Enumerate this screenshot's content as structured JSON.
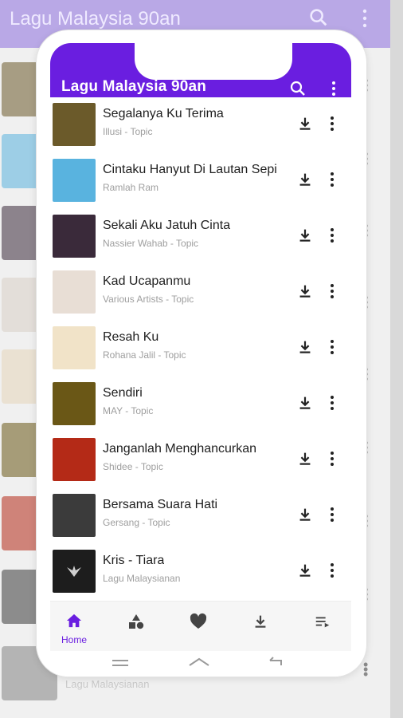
{
  "background": {
    "title": "Lagu Malaysia 90an",
    "last_item_subtitle": "Lagu Malaysianan"
  },
  "app": {
    "title": "Lagu Malaysia 90an",
    "accent": "#6a1ee0"
  },
  "songs": [
    {
      "title": "Segalanya Ku Terima",
      "artist": "Illusi - Topic",
      "thumb_color": "#6b5a2a"
    },
    {
      "title": "Cintaku Hanyut Di Lautan Sepi",
      "artist": "Ramlah Ram",
      "thumb_color": "#59b3df"
    },
    {
      "title": "Sekali Aku Jatuh Cinta",
      "artist": "Nassier Wahab - Topic",
      "thumb_color": "#3a2a3a"
    },
    {
      "title": "Kad Ucapanmu",
      "artist": "Various Artists - Topic",
      "thumb_color": "#e8ded5"
    },
    {
      "title": "Resah Ku",
      "artist": "Rohana Jalil - Topic",
      "thumb_color": "#f1e3c8"
    },
    {
      "title": "Sendiri",
      "artist": "MAY - Topic",
      "thumb_color": "#6a5716"
    },
    {
      "title": "Janganlah Menghancurkan",
      "artist": "Shidee - Topic",
      "thumb_color": "#b42a17"
    },
    {
      "title": "Bersama Suara Hati",
      "artist": "Gersang - Topic",
      "thumb_color": "#3b3b3b"
    },
    {
      "title": "Kris - Tiara",
      "artist": "Lagu Malaysianan",
      "thumb_color": "#1d1d1d"
    }
  ],
  "bottom_nav": {
    "items": [
      {
        "label": "Home",
        "icon": "home-icon",
        "active": true
      },
      {
        "label": "",
        "icon": "categories-icon",
        "active": false
      },
      {
        "label": "",
        "icon": "heart-icon",
        "active": false
      },
      {
        "label": "",
        "icon": "download-icon",
        "active": false
      },
      {
        "label": "",
        "icon": "playlist-icon",
        "active": false
      }
    ]
  }
}
